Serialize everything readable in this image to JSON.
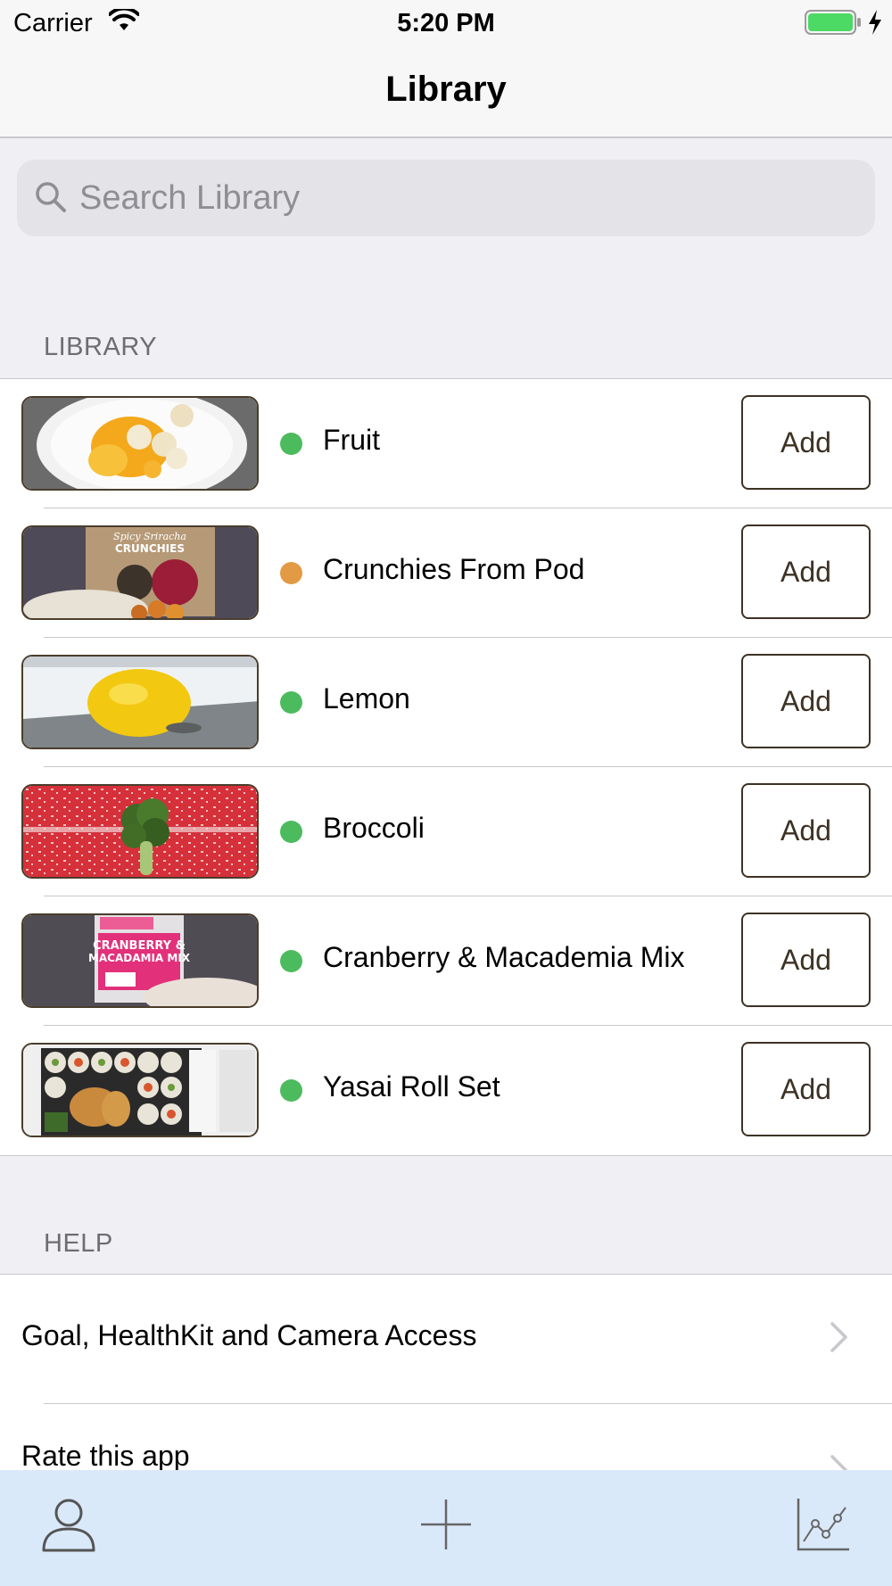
{
  "status_bar": {
    "carrier": "Carrier",
    "time": "5:20 PM"
  },
  "nav": {
    "title": "Library"
  },
  "search": {
    "placeholder": "Search Library",
    "value": ""
  },
  "library": {
    "header": "LIBRARY",
    "add_label": "Add",
    "items": [
      {
        "label": "Fruit",
        "status_color": "#4cbb5e"
      },
      {
        "label": "Crunchies From Pod",
        "status_color": "#e39a45"
      },
      {
        "label": "Lemon",
        "status_color": "#4cbb5e"
      },
      {
        "label": "Broccoli",
        "status_color": "#4cbb5e"
      },
      {
        "label": "Cranberry & Macademia Mix",
        "status_color": "#4cbb5e"
      },
      {
        "label": "Yasai Roll Set",
        "status_color": "#4cbb5e"
      }
    ]
  },
  "help": {
    "header": "HELP",
    "items": [
      {
        "label": "Goal, HealthKit and Camera Access"
      },
      {
        "label": "Rate this app"
      }
    ]
  },
  "tab_bar": {
    "tabs": [
      {
        "icon": "person-icon"
      },
      {
        "icon": "plus-icon"
      },
      {
        "icon": "chart-icon"
      }
    ]
  },
  "colors": {
    "accent_brown": "#3d3224",
    "tab_bar_bg": "#dae9fa",
    "status_green": "#4cbb5e",
    "status_orange": "#e39a45"
  }
}
